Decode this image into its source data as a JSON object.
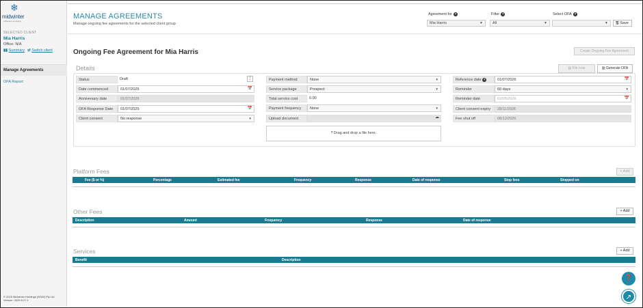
{
  "sidebar": {
    "logo_text": "midwinter",
    "logo_tagline": "a Bravura company",
    "selected_label": "SELECTED CLIENT",
    "client_name": "Mia Harris",
    "office": "Office: N/A",
    "summary_link": "Summary",
    "switch_link": "Switch client",
    "nav": [
      {
        "label": "Manage Agreements"
      },
      {
        "label": "OFA Report"
      }
    ],
    "footer_line1": "© 2025 Midwinter Holdings (NSW) Pty Ltd",
    "footer_line2": "Version: 2025.6.27.1"
  },
  "header": {
    "title": "MANAGE AGREEMENTS",
    "subtitle": "Manage ongoing fee agreements for the selected client group",
    "agreement_for_label": "Agreement for",
    "agreement_for_value": "Mia Harris",
    "filter_label": "Filter",
    "filter_value": "All",
    "select_ofa_label": "Select OFA",
    "select_ofa_value": "",
    "save_label": "Save"
  },
  "ofa": {
    "title": "Ongoing Fee Agreement for Mia Harris",
    "create_label": "Create Ongoing Fee Agreement"
  },
  "details": {
    "title": "Details",
    "file_note_label": "File note",
    "generate_label": "Generate OFA",
    "col1": [
      {
        "label": "Status",
        "value": "Draft"
      },
      {
        "label": "Date commenced",
        "value": "01/07/2025"
      },
      {
        "label": "Anniversary date",
        "value": "01/07/2026"
      },
      {
        "label": "OFA Response Date",
        "value": "01/07/2025"
      },
      {
        "label": "Client consent",
        "value": "No response"
      }
    ],
    "col2": [
      {
        "label": "Payment method",
        "value": "None"
      },
      {
        "label": "Service package",
        "value": "Prospect"
      },
      {
        "label": "Total service cost",
        "value": "0.00"
      },
      {
        "label": "Payment frequency",
        "value": "None"
      },
      {
        "label": "Upload document",
        "value": ""
      }
    ],
    "col3": [
      {
        "label": "Reference date",
        "value": "01/07/2026"
      },
      {
        "label": "Reminder",
        "value": "60 days"
      },
      {
        "label": "Reminder date",
        "value": "02/05/2026"
      },
      {
        "label": "Client consent expiry",
        "value": "28/11/2026"
      },
      {
        "label": "Fee shut off",
        "value": "08/12/2026"
      }
    ],
    "dropzone_text": "Drag and drop a file here."
  },
  "platform_fees": {
    "title": "Platform Fees",
    "add_label": "+ Add",
    "columns": [
      "Fee ($ or %)",
      "Percentage",
      "Estimated fee",
      "Frequency",
      "Response",
      "Date of response",
      "Stop fees",
      "Stopped on"
    ]
  },
  "other_fees": {
    "title": "Other Fees",
    "add_label": "+ Add",
    "columns": [
      "Description",
      "Amount",
      "Frequency",
      "Response",
      "Date of response"
    ]
  },
  "services": {
    "title": "Services",
    "add_label": "+ Add",
    "columns": [
      "Benefit",
      "Description"
    ]
  },
  "colors": {
    "accent": "#1a7a8f",
    "link": "#1a7c95"
  }
}
